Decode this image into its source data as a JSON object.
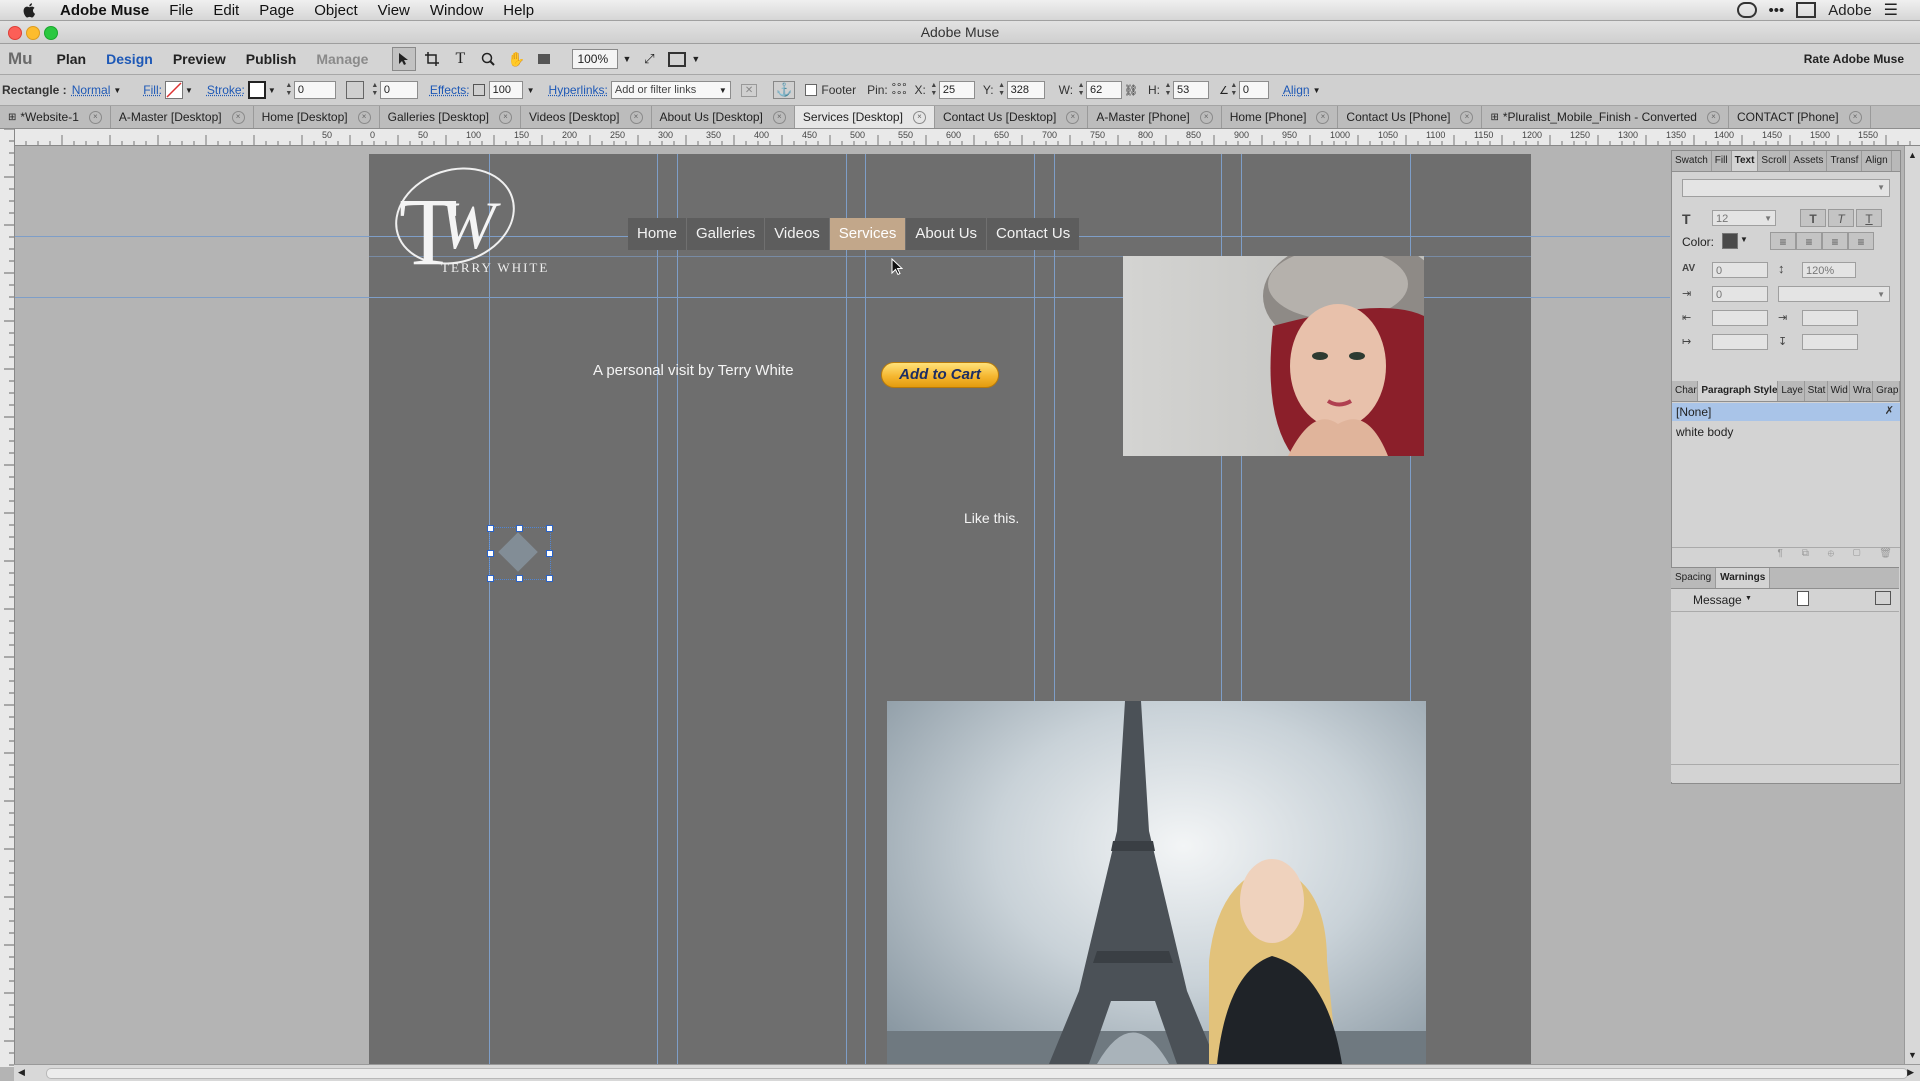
{
  "menubar": {
    "app_name": "Adobe Muse",
    "items": [
      "File",
      "Edit",
      "Page",
      "Object",
      "View",
      "Window",
      "Help"
    ],
    "right_label": "Adobe"
  },
  "window": {
    "title": "Adobe Muse"
  },
  "modebar": {
    "logo": "Mu",
    "modes": [
      "Plan",
      "Design",
      "Preview",
      "Publish",
      "Manage"
    ],
    "active_mode": "Design",
    "zoom": "100%",
    "rate_label": "Rate Adobe Muse"
  },
  "controlbar": {
    "selection_type": "Rectangle :",
    "blend_mode": "Normal",
    "fill_label": "Fill:",
    "stroke_label": "Stroke:",
    "stroke_value": "0",
    "corner_value": "0",
    "effects_label": "Effects:",
    "opacity": "100",
    "hyperlinks_label": "Hyperlinks:",
    "hyperlinks_placeholder": "Add or filter links",
    "footer_label": "Footer",
    "pin_label": "Pin:",
    "x_label": "X:",
    "x_value": "25",
    "y_label": "Y:",
    "y_value": "328",
    "w_label": "W:",
    "w_value": "62",
    "h_label": "H:",
    "h_value": "53",
    "rotation_value": "0",
    "align_label": "Align"
  },
  "tabs": [
    {
      "label": "*Website-1",
      "active": false
    },
    {
      "label": "A-Master [Desktop]",
      "active": false
    },
    {
      "label": "Home [Desktop]",
      "active": false
    },
    {
      "label": "Galleries [Desktop]",
      "active": false
    },
    {
      "label": "Videos [Desktop]",
      "active": false
    },
    {
      "label": "About Us [Desktop]",
      "active": false
    },
    {
      "label": "Services [Desktop]",
      "active": true
    },
    {
      "label": "Contact Us [Desktop]",
      "active": false
    },
    {
      "label": "A-Master [Phone]",
      "active": false
    },
    {
      "label": "Home [Phone]",
      "active": false
    },
    {
      "label": "Contact Us [Phone]",
      "active": false
    },
    {
      "label": "*Pluralist_Mobile_Finish - Converted",
      "active": false
    },
    {
      "label": "CONTACT [Phone]",
      "active": false
    }
  ],
  "ruler_labels": [
    "50",
    "0",
    "50",
    "100",
    "150",
    "200",
    "250",
    "300",
    "350",
    "400",
    "450",
    "500",
    "550",
    "600",
    "650",
    "700",
    "750",
    "800",
    "850",
    "900",
    "950",
    "1000",
    "1050",
    "1100",
    "1150",
    "1200",
    "1250",
    "1300",
    "1350",
    "1400",
    "1450",
    "1500",
    "1550"
  ],
  "site": {
    "logo_initials": "TW",
    "logo_name": "TERRY WHITE",
    "nav": [
      "Home",
      "Galleries",
      "Videos",
      "Services",
      "About Us",
      "Contact Us"
    ],
    "active_nav": "Services",
    "visit_text": "A personal visit by Terry White",
    "cart_button": "Add to Cart",
    "like_text": "Like this."
  },
  "text_panel": {
    "tabs": [
      "Swatch",
      "Fill",
      "Text",
      "Scroll",
      "Assets",
      "Transf",
      "Align"
    ],
    "active_tab": "Text",
    "font_size": "12",
    "color_label": "Color:",
    "tracking": "0",
    "leading": "120%",
    "space_before": "0"
  },
  "styles_panel": {
    "tabs": [
      "Char",
      "Paragraph Styles",
      "Laye",
      "Stat",
      "Wid",
      "Wra",
      "Grap"
    ],
    "active_tab": "Paragraph Styles",
    "items": [
      "[None]",
      "white body"
    ],
    "selected": "[None]"
  },
  "bottom_panel": {
    "tabs": [
      "Spacing",
      "Warnings"
    ],
    "active_tab": "Warnings",
    "message_label": "Message"
  },
  "colors": {
    "accent": "#1d58b6",
    "active_nav": "#c2a78a",
    "cart_gold": "#f5b731",
    "guide": "#7e9ec8"
  }
}
